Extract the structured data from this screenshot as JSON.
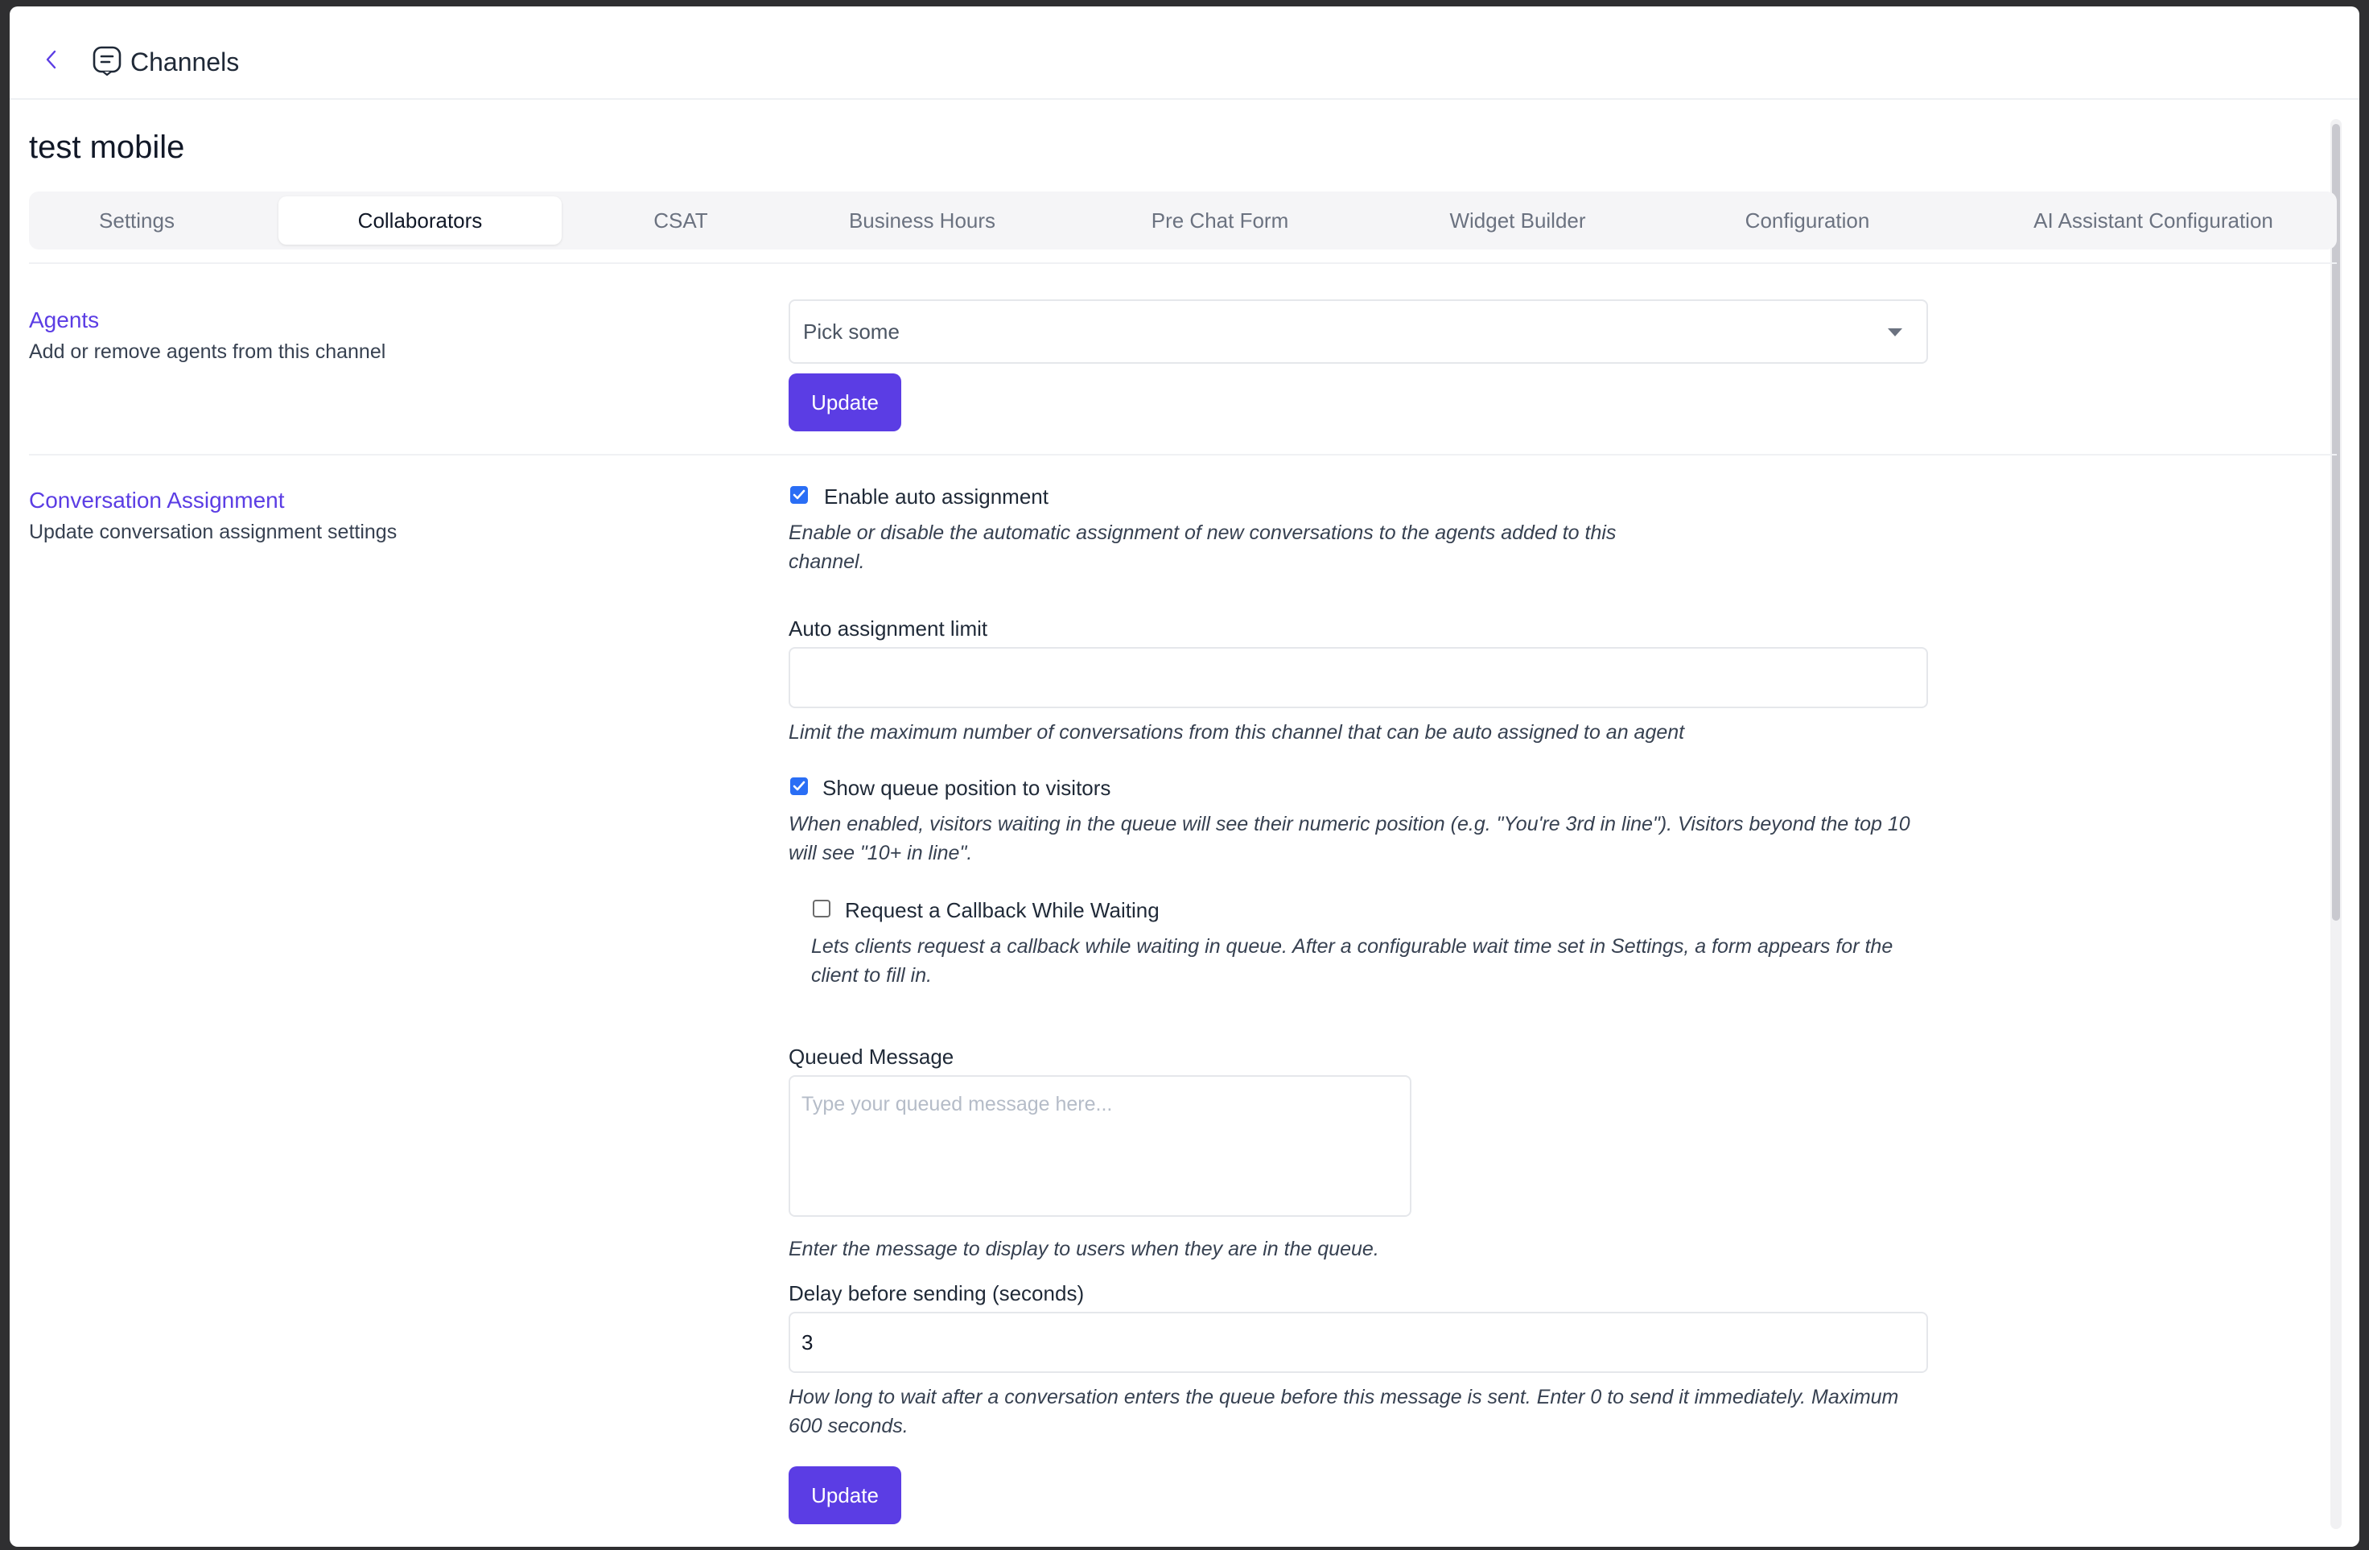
{
  "header": {
    "title": "Channels"
  },
  "page": {
    "title": "test mobile"
  },
  "tabs": [
    "Settings",
    "Collaborators",
    "CSAT",
    "Business Hours",
    "Pre Chat Form",
    "Widget Builder",
    "Configuration",
    "AI Assistant Configuration"
  ],
  "active_tab": "Collaborators",
  "agents": {
    "title": "Agents",
    "subtitle": "Add or remove agents from this channel",
    "select_placeholder": "Pick some",
    "update_label": "Update"
  },
  "assignment": {
    "title": "Conversation Assignment",
    "subtitle": "Update conversation assignment settings",
    "auto_assign": {
      "label": "Enable auto assignment",
      "checked": true,
      "help": "Enable or disable the automatic assignment of new conversations to the agents added to this channel."
    },
    "limit": {
      "label": "Auto assignment limit",
      "value": "",
      "help": "Limit the maximum number of conversations from this channel that can be auto assigned to an agent"
    },
    "queue_position": {
      "label": "Show queue position to visitors",
      "checked": true,
      "help": "When enabled, visitors waiting in the queue will see their numeric position (e.g. \"You're 3rd in line\"). Visitors beyond the top 10 will see \"10+ in line\"."
    },
    "callback": {
      "label": "Request a Callback While Waiting",
      "checked": false,
      "help": "Lets clients request a callback while waiting in queue. After a configurable wait time set in Settings, a form appears for the client to fill in."
    },
    "queued_message": {
      "label": "Queued Message",
      "placeholder": "Type your queued message here...",
      "help": "Enter the message to display to users when they are in the queue."
    },
    "delay": {
      "label": "Delay before sending (seconds)",
      "value": "3",
      "help": "How long to wait after a conversation enters the queue before this message is sent. Enter 0 to send it immediately. Maximum 600 seconds."
    },
    "update_label": "Update"
  },
  "colors": {
    "accent": "#5b3de4",
    "checkbox": "#2a6ef5"
  }
}
